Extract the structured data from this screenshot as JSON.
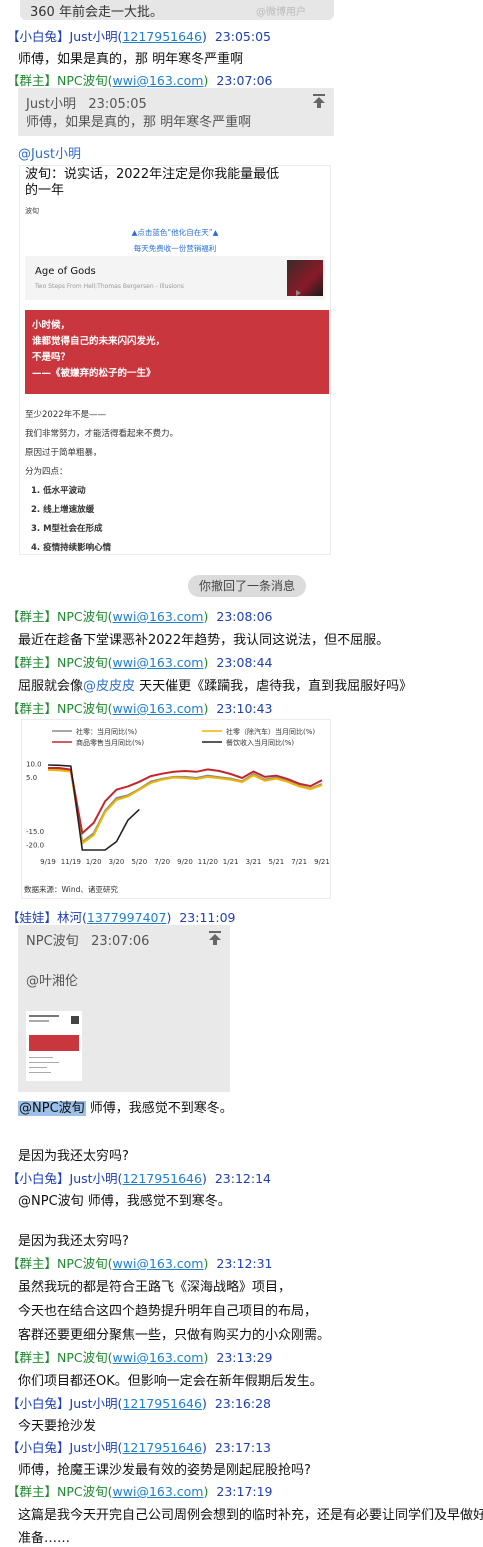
{
  "top_snippet": "360 年前会走一大批。",
  "top_watermark": "@微博用户",
  "msg1": {
    "role": "【小白兔】",
    "name": "Just小明",
    "id": "1217951646",
    "time": "23:05:05",
    "text": "师傅，如果是真的，那 明年寒冬严重啊"
  },
  "msg2": {
    "role": "【群主】",
    "name": "NPC波旬",
    "email": "wwi@163.com",
    "time": "23:07:06",
    "quote_name": "Just小明",
    "quote_time": "23:05:05",
    "quote_text": "师傅，如果是真的，那 明年寒冬严重啊",
    "mention": "@Just小明",
    "article": {
      "title_l1": "波旬：说实话，2022年注定是你我能量最低",
      "title_l2": "的一年",
      "author": "波旬",
      "banner_l1": "▲点击蓝色“他化自在天”▲",
      "banner_l2": "每天免费收一份营销福利",
      "music_title": "Age of Gods",
      "music_sub": "Two Steps From Hell;Thomas Bergersen - Illusions",
      "red_l1": "小时候，",
      "red_l2": "谁都觉得自己的未来闪闪发光，",
      "red_l3": "不是吗？",
      "red_l4": "——《被嫌弃的松子的一生》",
      "p1": "至少2022年不是——",
      "p2": "我们非常努力，才能活得看起来不费力。",
      "p3": "原因过于简单粗暴，",
      "p4": "分为四点：",
      "items": [
        "1.  低水平波动",
        "2.  线上增速放缓",
        "3.  M型社会在形成",
        "4.  疫情持续影响心情"
      ]
    }
  },
  "recall_notice": "你撤回了一条消息",
  "msg3": {
    "role": "【群主】",
    "name": "NPC波旬",
    "email": "wwi@163.com",
    "time": "23:08:06",
    "text": "最近在趁备下堂课恶补2022年趋势，我认同这说法，但不屈服。"
  },
  "msg4": {
    "role": "【群主】",
    "name": "NPC波旬",
    "email": "wwi@163.com",
    "time": "23:08:44",
    "text_a": "屈服就会像",
    "mention": "@皮皮皮",
    "text_b": " 天天催更《蹂躏我，虐待我，直到我屈服好吗》"
  },
  "msg5": {
    "role": "【群主】",
    "name": "NPC波旬",
    "email": "wwi@163.com",
    "time": "23:10:43"
  },
  "chart_data": {
    "type": "line",
    "legend": [
      "社零：当月同比(%)",
      "社零（除汽车）当月同比(%)",
      "商品零售当月同比(%)",
      "餐饮收入当月同比(%)"
    ],
    "colors": {
      "s1": "#8c8c8c",
      "s2": "#f0b400",
      "s3": "#c0282e",
      "s4": "#222222"
    },
    "x_ticks": [
      "9/19",
      "11/19",
      "1/20",
      "3/20",
      "5/20",
      "7/20",
      "9/20",
      "11/20",
      "1/21",
      "3/21",
      "5/21",
      "7/21",
      "9/21"
    ],
    "y_ticks": [
      "10.0",
      "5.0",
      "-15.0",
      "-20.0"
    ],
    "source": "数据来源：Wind、诸亚研究",
    "series": [
      {
        "name": "社零：当月同比(%)",
        "values": [
          7.8,
          7.8,
          7.2,
          -19.0,
          -15.8,
          -7.5,
          -2.8,
          -1.8,
          0.5,
          3.3,
          4.3,
          5.0,
          5.0,
          4.6,
          5.5,
          4.9,
          4.4,
          3.4,
          6.1,
          4.0,
          4.8,
          3.5,
          1.8,
          0.7,
          2.4
        ]
      },
      {
        "name": "社零（除汽车）当月同比(%)",
        "values": [
          7.6,
          7.4,
          7.0,
          -19.5,
          -16.5,
          -8.0,
          -3.5,
          -2.2,
          0.3,
          2.8,
          4.0,
          4.8,
          4.6,
          4.2,
          5.0,
          4.5,
          4.0,
          3.1,
          5.6,
          3.6,
          4.4,
          3.2,
          1.5,
          0.5,
          2.0
        ]
      },
      {
        "name": "商品零售当月同比(%)",
        "values": [
          8.3,
          8.3,
          7.7,
          -15.8,
          -12.0,
          -4.0,
          0.3,
          1.5,
          3.2,
          5.3,
          6.2,
          6.9,
          7.2,
          6.9,
          7.8,
          7.2,
          6.1,
          4.6,
          7.0,
          5.0,
          5.5,
          4.2,
          2.5,
          1.6,
          3.8
        ]
      },
      {
        "name": "餐饮收入当月同比(%)",
        "values": [
          9.4,
          9.3,
          9.0,
          -43.0,
          -46.8,
          -31.1,
          -18.9,
          -11.0,
          -7.0
        ]
      }
    ]
  },
  "msg6": {
    "role": "【娃娃】",
    "name": "林河",
    "id": "1377997407",
    "time": "23:11:09",
    "quote_name": "NPC波旬",
    "quote_time": "23:07:06",
    "quote_mention": "@叶湘伦",
    "mention": "@NPC波旬",
    "text": " 师傅，我感觉不到寒冬。",
    "text2": "是因为我还太穷吗?"
  },
  "msg7": {
    "role": "【小白兔】",
    "name": "Just小明",
    "id": "1217951646",
    "time": "23:12:14",
    "text": "@NPC波旬 师傅，我感觉不到寒冬。",
    "text2": "是因为我还太穷吗?"
  },
  "msg8": {
    "role": "【群主】",
    "name": "NPC波旬",
    "email": "wwi@163.com",
    "time": "23:12:31",
    "l1": "虽然我玩的都是符合王路飞《深海战略》项目，",
    "l2": "今天也在结合这四个趋势提升明年自己项目的布局，",
    "l3": "客群还要更细分聚焦一些，只做有购买力的小众刚需。"
  },
  "msg9": {
    "role": "【群主】",
    "name": "NPC波旬",
    "email": "wwi@163.com",
    "time": "23:13:29",
    "text": "你们项目都还OK。但影响一定会在新年假期后发生。"
  },
  "msg10": {
    "role": "【小白兔】",
    "name": "Just小明",
    "id": "1217951646",
    "time": "23:16:28",
    "text": "今天要抢沙发"
  },
  "msg11": {
    "role": "【小白兔】",
    "name": "Just小明",
    "id": "1217951646",
    "time": "23:17:13",
    "text": "师傅，抢魔王课沙发最有效的姿势是刚起屁股抢吗?"
  },
  "msg12": {
    "role": "【群主】",
    "name": "NPC波旬",
    "email": "wwi@163.com",
    "time": "23:17:19",
    "l1": "这篇是我今天开完自己公司周例会想到的临时补充，还是有必要让同学们及早做好",
    "l2": "准备……"
  }
}
